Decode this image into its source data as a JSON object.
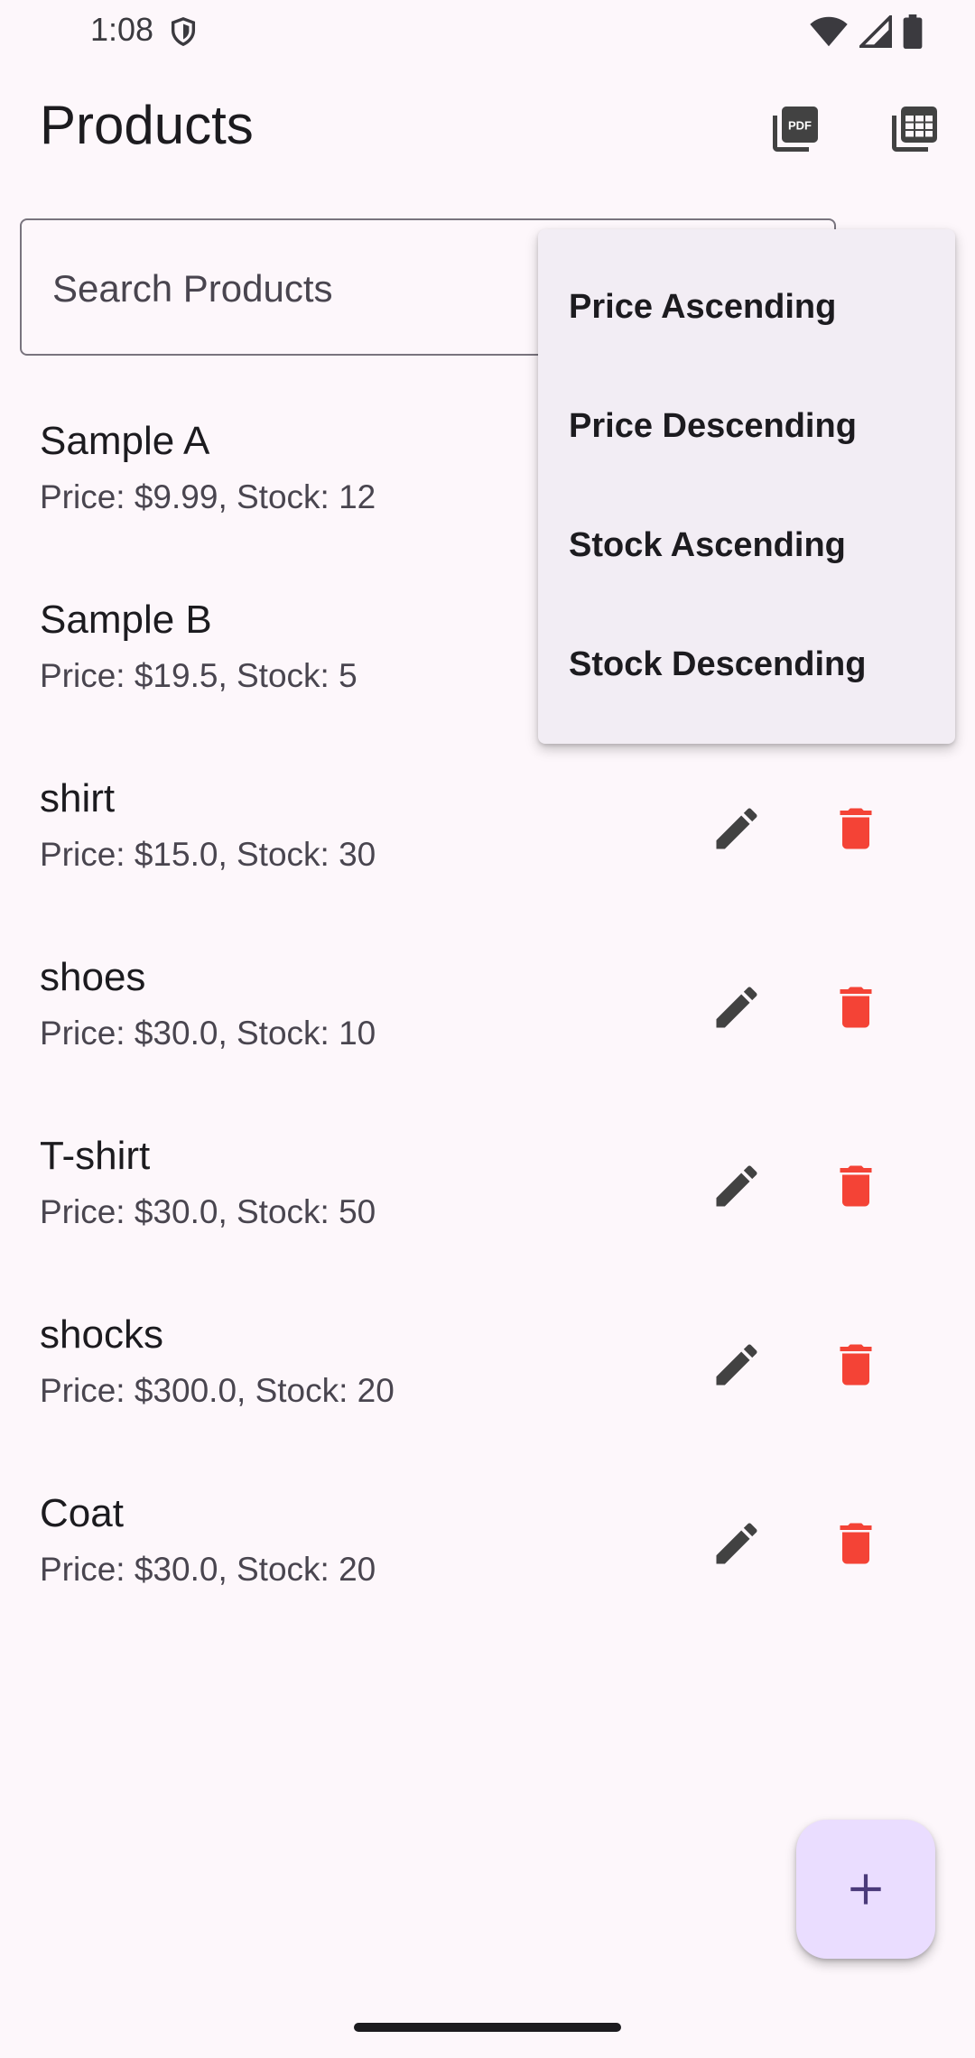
{
  "status_bar": {
    "time": "1:08"
  },
  "app_bar": {
    "title": "Products",
    "pdf_icon": "picture-as-pdf-icon",
    "sheet_icon": "table-spreadsheet-icon"
  },
  "search": {
    "placeholder": "Search Products",
    "value": ""
  },
  "products": [
    {
      "name": "Sample A",
      "detail": "Price: $9.99, Stock: 12"
    },
    {
      "name": "Sample B",
      "detail": "Price: $19.5, Stock: 5"
    },
    {
      "name": "shirt",
      "detail": "Price: $15.0, Stock: 30"
    },
    {
      "name": "shoes",
      "detail": "Price: $30.0, Stock: 10"
    },
    {
      "name": "T-shirt",
      "detail": "Price: $30.0, Stock: 50"
    },
    {
      "name": "shocks",
      "detail": "Price: $300.0, Stock: 20"
    },
    {
      "name": "Coat",
      "detail": "Price: $30.0, Stock: 20"
    }
  ],
  "sort_menu": {
    "items": [
      "Price Ascending",
      "Price Descending",
      "Stock Ascending",
      "Stock Descending"
    ]
  },
  "fab": {
    "icon": "add-icon"
  },
  "colors": {
    "background": "#fdf7fb",
    "delete_red": "#f44336",
    "edit_gray": "#424242",
    "fab_bg": "#eaddff",
    "fab_icon": "#4a3a7a",
    "menu_bg": "#f2edf4"
  }
}
